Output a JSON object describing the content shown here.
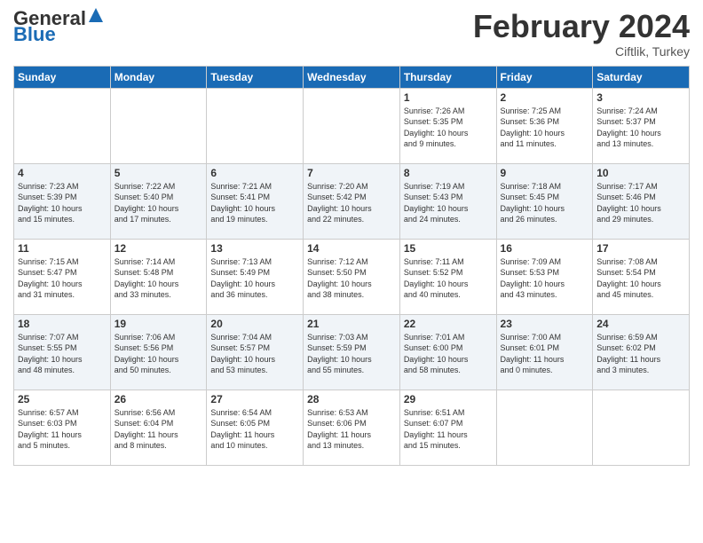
{
  "header": {
    "logo_general": "General",
    "logo_blue": "Blue",
    "month_title": "February 2024",
    "location": "Ciftlik, Turkey"
  },
  "weekdays": [
    "Sunday",
    "Monday",
    "Tuesday",
    "Wednesday",
    "Thursday",
    "Friday",
    "Saturday"
  ],
  "weeks": [
    [
      {
        "day": "",
        "info": ""
      },
      {
        "day": "",
        "info": ""
      },
      {
        "day": "",
        "info": ""
      },
      {
        "day": "",
        "info": ""
      },
      {
        "day": "1",
        "info": "Sunrise: 7:26 AM\nSunset: 5:35 PM\nDaylight: 10 hours\nand 9 minutes."
      },
      {
        "day": "2",
        "info": "Sunrise: 7:25 AM\nSunset: 5:36 PM\nDaylight: 10 hours\nand 11 minutes."
      },
      {
        "day": "3",
        "info": "Sunrise: 7:24 AM\nSunset: 5:37 PM\nDaylight: 10 hours\nand 13 minutes."
      }
    ],
    [
      {
        "day": "4",
        "info": "Sunrise: 7:23 AM\nSunset: 5:39 PM\nDaylight: 10 hours\nand 15 minutes."
      },
      {
        "day": "5",
        "info": "Sunrise: 7:22 AM\nSunset: 5:40 PM\nDaylight: 10 hours\nand 17 minutes."
      },
      {
        "day": "6",
        "info": "Sunrise: 7:21 AM\nSunset: 5:41 PM\nDaylight: 10 hours\nand 19 minutes."
      },
      {
        "day": "7",
        "info": "Sunrise: 7:20 AM\nSunset: 5:42 PM\nDaylight: 10 hours\nand 22 minutes."
      },
      {
        "day": "8",
        "info": "Sunrise: 7:19 AM\nSunset: 5:43 PM\nDaylight: 10 hours\nand 24 minutes."
      },
      {
        "day": "9",
        "info": "Sunrise: 7:18 AM\nSunset: 5:45 PM\nDaylight: 10 hours\nand 26 minutes."
      },
      {
        "day": "10",
        "info": "Sunrise: 7:17 AM\nSunset: 5:46 PM\nDaylight: 10 hours\nand 29 minutes."
      }
    ],
    [
      {
        "day": "11",
        "info": "Sunrise: 7:15 AM\nSunset: 5:47 PM\nDaylight: 10 hours\nand 31 minutes."
      },
      {
        "day": "12",
        "info": "Sunrise: 7:14 AM\nSunset: 5:48 PM\nDaylight: 10 hours\nand 33 minutes."
      },
      {
        "day": "13",
        "info": "Sunrise: 7:13 AM\nSunset: 5:49 PM\nDaylight: 10 hours\nand 36 minutes."
      },
      {
        "day": "14",
        "info": "Sunrise: 7:12 AM\nSunset: 5:50 PM\nDaylight: 10 hours\nand 38 minutes."
      },
      {
        "day": "15",
        "info": "Sunrise: 7:11 AM\nSunset: 5:52 PM\nDaylight: 10 hours\nand 40 minutes."
      },
      {
        "day": "16",
        "info": "Sunrise: 7:09 AM\nSunset: 5:53 PM\nDaylight: 10 hours\nand 43 minutes."
      },
      {
        "day": "17",
        "info": "Sunrise: 7:08 AM\nSunset: 5:54 PM\nDaylight: 10 hours\nand 45 minutes."
      }
    ],
    [
      {
        "day": "18",
        "info": "Sunrise: 7:07 AM\nSunset: 5:55 PM\nDaylight: 10 hours\nand 48 minutes."
      },
      {
        "day": "19",
        "info": "Sunrise: 7:06 AM\nSunset: 5:56 PM\nDaylight: 10 hours\nand 50 minutes."
      },
      {
        "day": "20",
        "info": "Sunrise: 7:04 AM\nSunset: 5:57 PM\nDaylight: 10 hours\nand 53 minutes."
      },
      {
        "day": "21",
        "info": "Sunrise: 7:03 AM\nSunset: 5:59 PM\nDaylight: 10 hours\nand 55 minutes."
      },
      {
        "day": "22",
        "info": "Sunrise: 7:01 AM\nSunset: 6:00 PM\nDaylight: 10 hours\nand 58 minutes."
      },
      {
        "day": "23",
        "info": "Sunrise: 7:00 AM\nSunset: 6:01 PM\nDaylight: 11 hours\nand 0 minutes."
      },
      {
        "day": "24",
        "info": "Sunrise: 6:59 AM\nSunset: 6:02 PM\nDaylight: 11 hours\nand 3 minutes."
      }
    ],
    [
      {
        "day": "25",
        "info": "Sunrise: 6:57 AM\nSunset: 6:03 PM\nDaylight: 11 hours\nand 5 minutes."
      },
      {
        "day": "26",
        "info": "Sunrise: 6:56 AM\nSunset: 6:04 PM\nDaylight: 11 hours\nand 8 minutes."
      },
      {
        "day": "27",
        "info": "Sunrise: 6:54 AM\nSunset: 6:05 PM\nDaylight: 11 hours\nand 10 minutes."
      },
      {
        "day": "28",
        "info": "Sunrise: 6:53 AM\nSunset: 6:06 PM\nDaylight: 11 hours\nand 13 minutes."
      },
      {
        "day": "29",
        "info": "Sunrise: 6:51 AM\nSunset: 6:07 PM\nDaylight: 11 hours\nand 15 minutes."
      },
      {
        "day": "",
        "info": ""
      },
      {
        "day": "",
        "info": ""
      }
    ]
  ]
}
